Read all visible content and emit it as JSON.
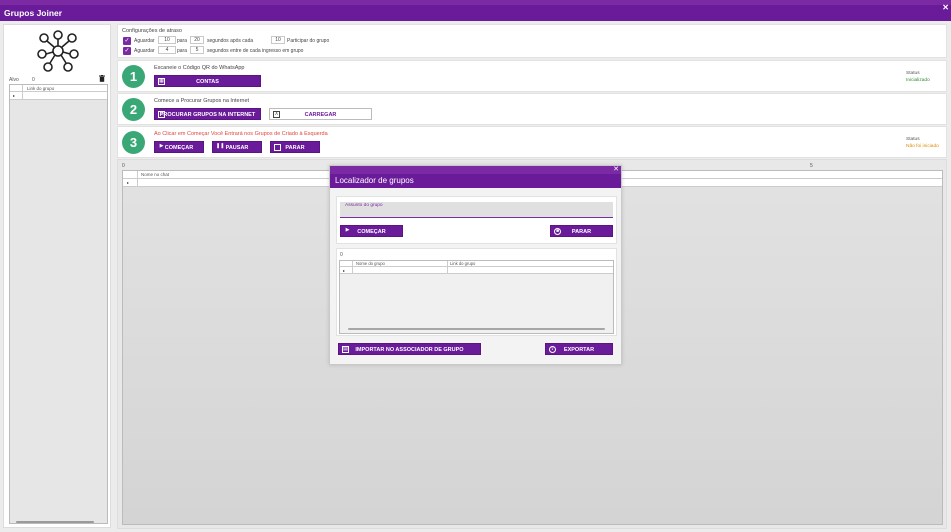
{
  "app": {
    "title": "Grupos Joiner"
  },
  "sidebar": {
    "alvo_label": "Alvo",
    "alvo_value": "0",
    "grid_header": "Link do grupo"
  },
  "config": {
    "title": "Configurações de atraso",
    "row1": {
      "aguardar": "Aguardar",
      "a": "10",
      "para": "para",
      "b": "20",
      "segundos": "segundos após cada",
      "c": "10",
      "tail": "Participar do grupo"
    },
    "row2": {
      "aguardar": "Aguardar",
      "a": "4",
      "para": "para",
      "b": "5",
      "tail": "segundos entre de cada ingresso em grupo"
    }
  },
  "step1": {
    "number": "1",
    "instruction": "Escaneie o Código QR do WhatsApp",
    "button": "CONTAS",
    "status_label": "Status",
    "status_value": "Inicializado"
  },
  "step2": {
    "number": "2",
    "instruction": "Comece a Procurar Grupos na Internet",
    "search_button": "PROCURAR GRUPOS NA INTERNET",
    "load_button": "CARREGAR"
  },
  "step3": {
    "number": "3",
    "instruction": "Ao Clicar em Começar Você Entrará nos Grupos de Criado à Esquerda",
    "start": "COMEÇAR",
    "pause": "PAUSAR",
    "stop": "PARAR",
    "status_label": "Status",
    "status_value": "Não foi iniciado"
  },
  "main": {
    "left_count": "0",
    "right_count": "5",
    "grid_header": "Nome no chat"
  },
  "dialog": {
    "title": "Localizador de grupos",
    "input_placeholder": "Assunto do grupo",
    "start": "COMEÇAR",
    "stop": "PARAR",
    "count": "0",
    "col1": "Nome do grupo",
    "col2": "Link do grupo",
    "import": "IMPORTAR NO ASSOCIADOR DE GRUPO",
    "export": "EXPORTAR"
  },
  "colors": {
    "purple": "#6a1b9a",
    "green_circle": "#3aa876",
    "status_ok": "#2e8b2e",
    "status_warn": "#e08a00",
    "instruction_red": "#e0453a"
  }
}
